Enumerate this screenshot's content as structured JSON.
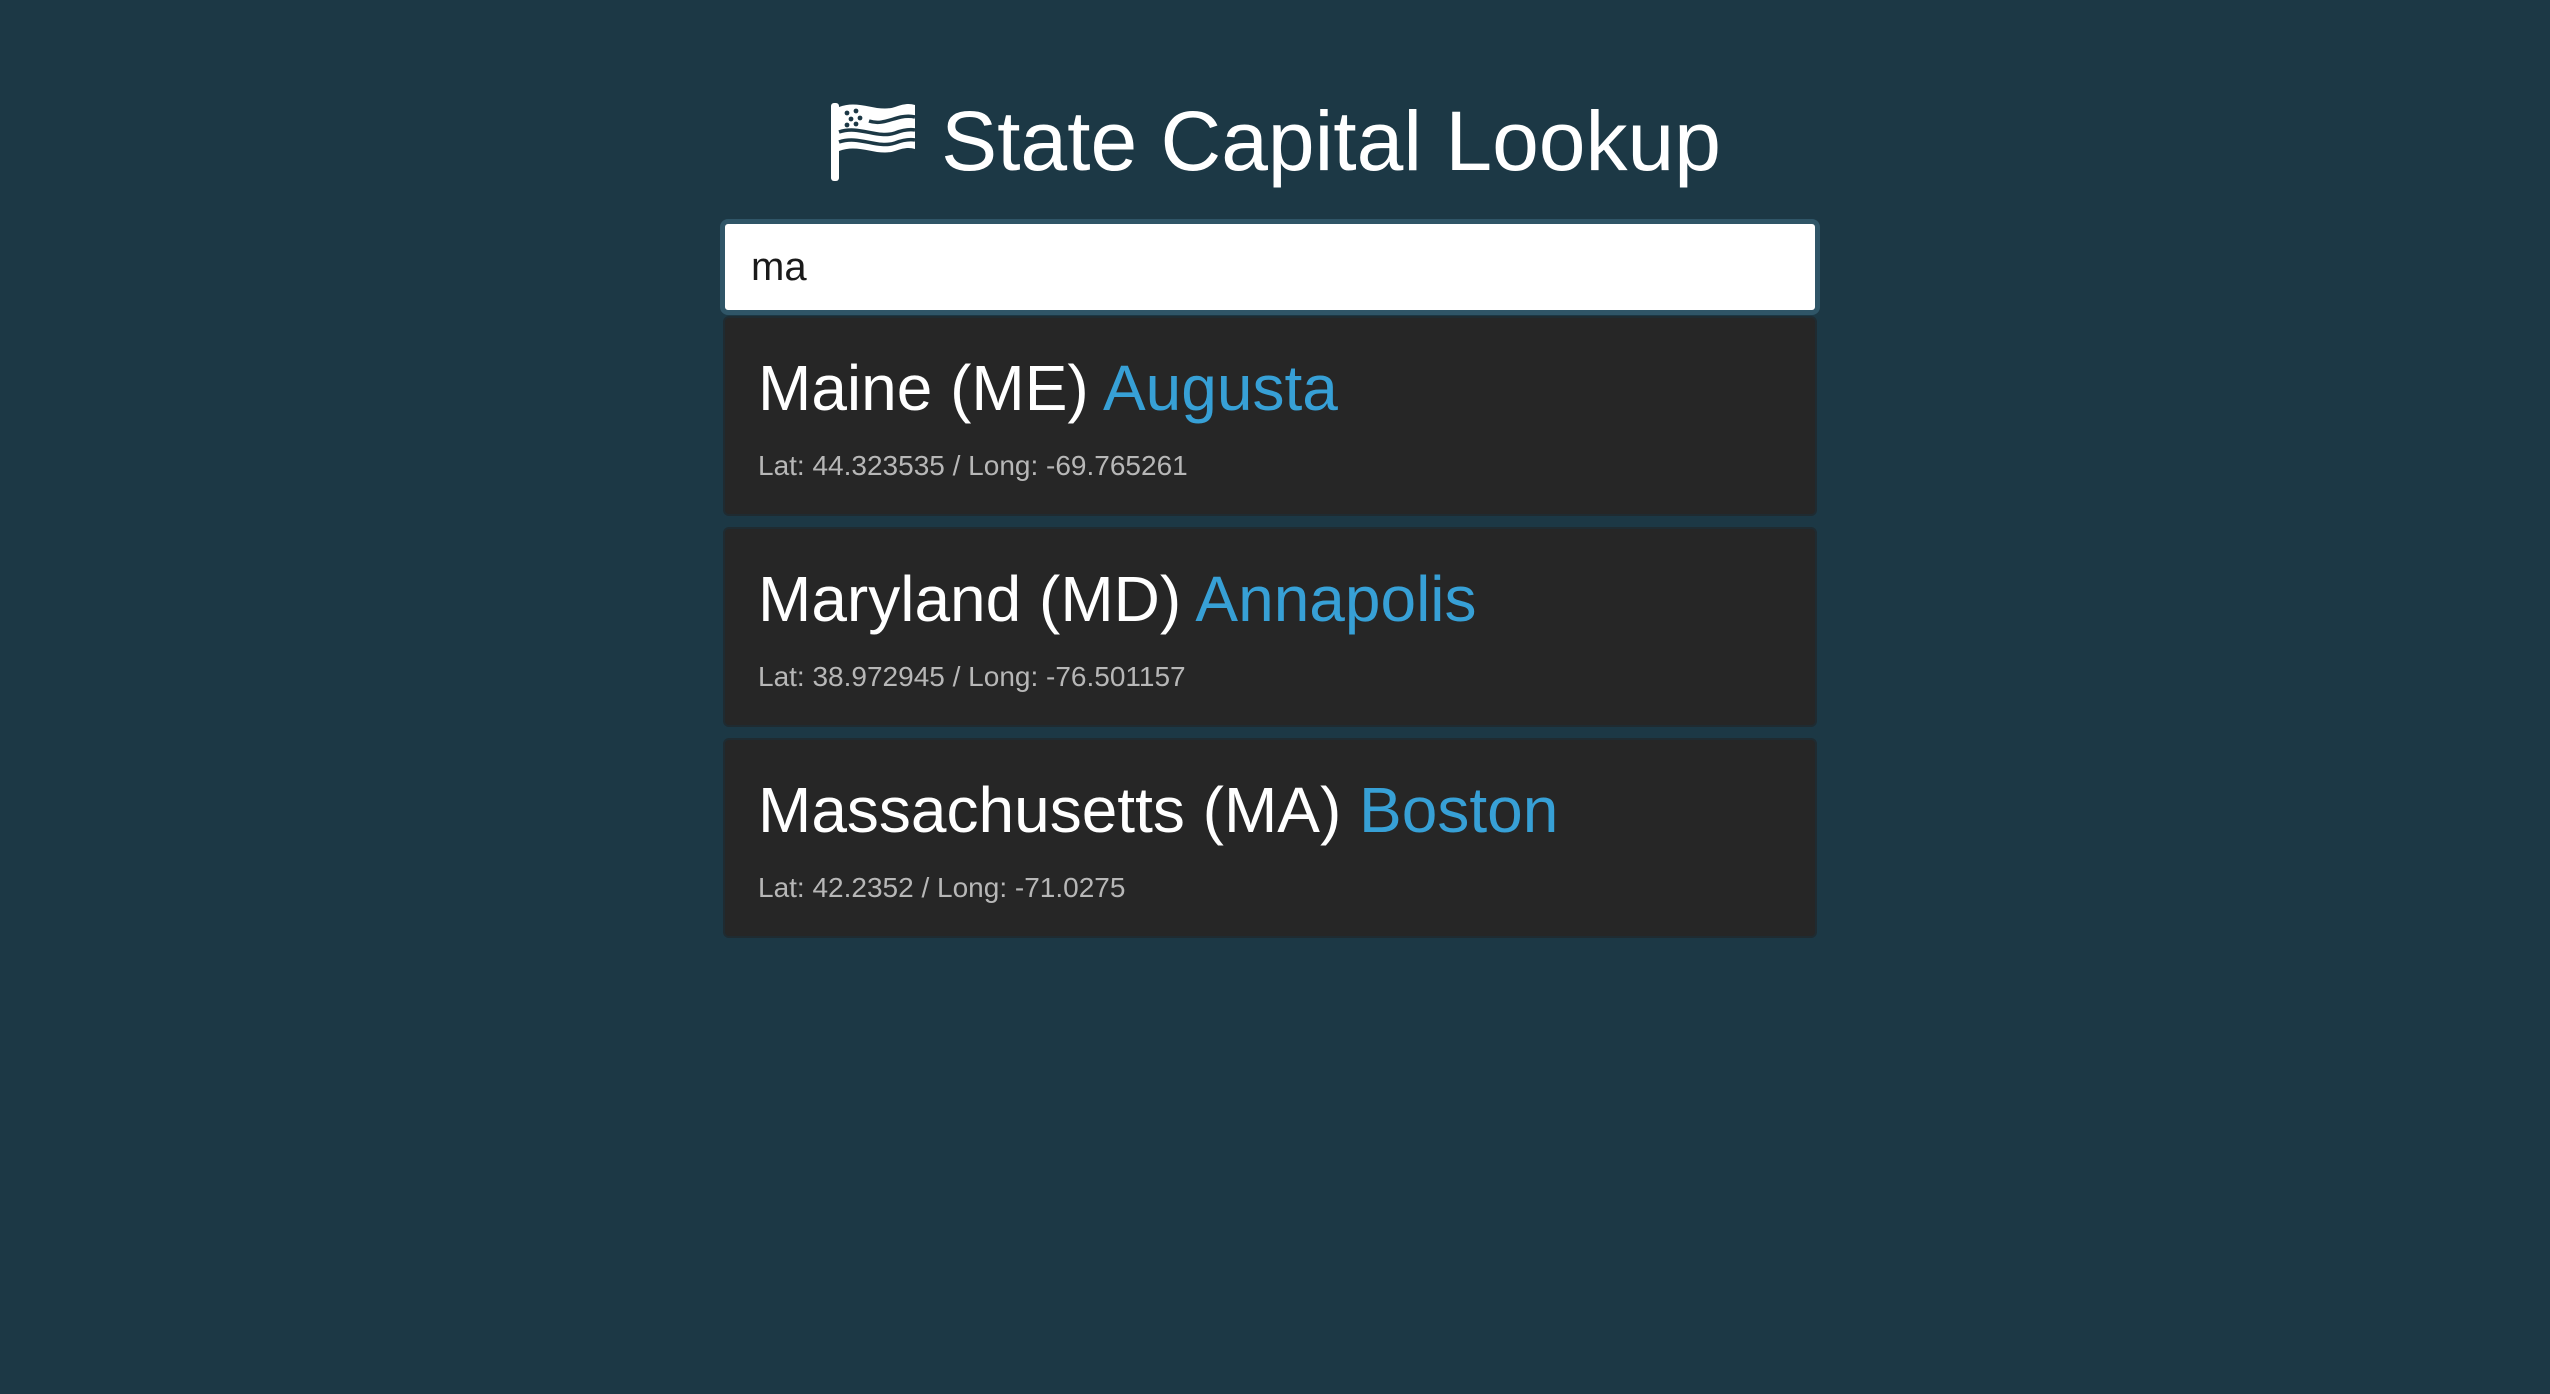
{
  "header": {
    "icon": "flag-icon",
    "title": "State Capital Lookup"
  },
  "search": {
    "value": "ma",
    "placeholder": ""
  },
  "theme": {
    "background": "#1c3845",
    "card": "#262626",
    "accent": "#37a0d6",
    "muted_text": "#b7b7b7"
  },
  "results": [
    {
      "state": "Maine (ME)",
      "capital": "Augusta",
      "coords": "Lat: 44.323535 / Long: -69.765261"
    },
    {
      "state": "Maryland (MD)",
      "capital": "Annapolis",
      "coords": "Lat: 38.972945 / Long: -76.501157"
    },
    {
      "state": "Massachusetts (MA)",
      "capital": "Boston",
      "coords": "Lat: 42.2352 / Long: -71.0275"
    }
  ]
}
